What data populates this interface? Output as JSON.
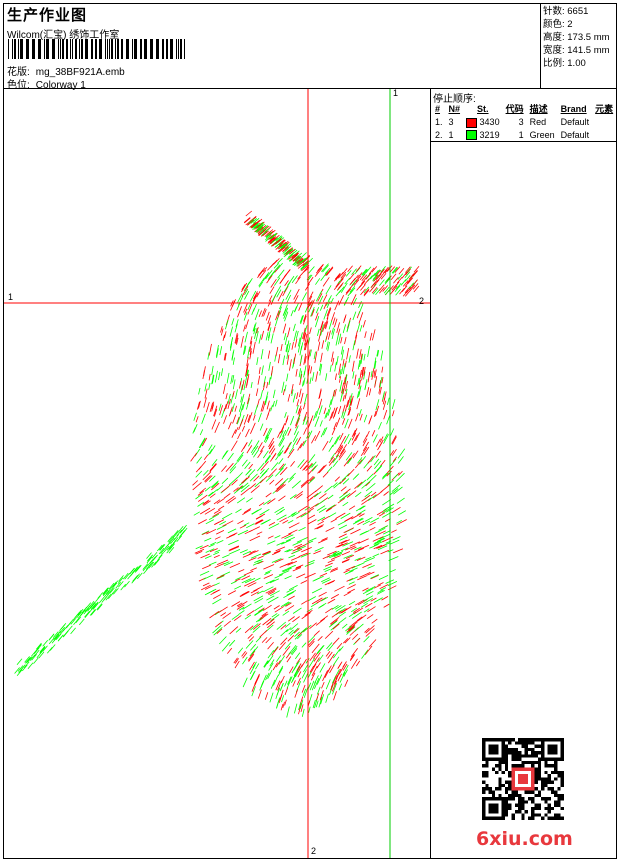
{
  "header": {
    "title": "生产作业图",
    "company": "Wilcom(汇宝) 绣饰工作室",
    "design_label": "花版:",
    "design_value": "mg_38BF921A.emb",
    "colorway_label": "色位:",
    "colorway_value": "Colorway 1"
  },
  "stats": {
    "stitches": "针数: 6651",
    "colors": "颜色: 2",
    "height": "高度: 173.5 mm",
    "width": "宽度: 141.5 mm",
    "scale": "比例: 1.00"
  },
  "stop_sequence": {
    "title": "停止顺序:",
    "columns": [
      "#",
      "N#",
      "St.",
      "代码",
      "描述",
      "Brand",
      "元素"
    ],
    "rows": [
      {
        "idx": "1.",
        "needle": "3",
        "color": "#ff0000",
        "stitches": "3430",
        "code": "3",
        "desc": "Red",
        "brand": "Default",
        "element": ""
      },
      {
        "idx": "2.",
        "needle": "1",
        "color": "#00ff00",
        "stitches": "3219",
        "code": "1",
        "desc": "Green",
        "brand": "Default",
        "element": ""
      }
    ]
  },
  "guides": {
    "h_left": "1",
    "h_right": "2",
    "v_top": "1",
    "v_bottom": "2"
  },
  "watermark": "6xiu.com",
  "colors": {
    "red": "#ff0000",
    "green": "#00ff00",
    "guide_red": "#ff0000",
    "guide_green": "#00cc00"
  }
}
